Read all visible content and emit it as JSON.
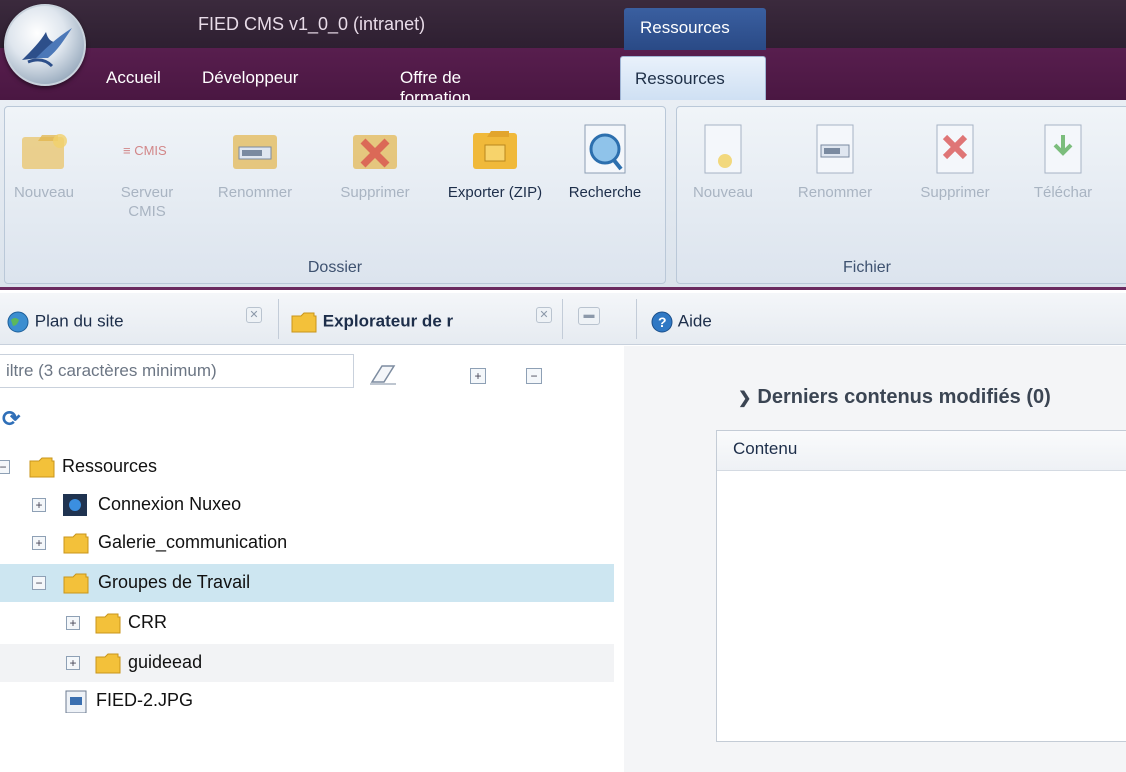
{
  "app": {
    "title": "FIED CMS v1_0_0 (intranet)",
    "context_tab": "Ressources"
  },
  "tabs": [
    {
      "label": "Accueil"
    },
    {
      "label": "Développeur"
    },
    {
      "label": "Offre de formation"
    },
    {
      "label": "Ressources",
      "active": true
    }
  ],
  "ribbon": {
    "dossier": {
      "label": "Dossier",
      "buttons": [
        {
          "label": "Nouveau",
          "icon": "folder-new-icon",
          "enabled": false
        },
        {
          "label": "Serveur CMIS",
          "icon": "cmis-icon",
          "enabled": false
        },
        {
          "label": "Renommer",
          "icon": "folder-rename-icon",
          "enabled": false
        },
        {
          "label": "Supprimer",
          "icon": "folder-delete-icon",
          "enabled": false
        },
        {
          "label": "Exporter (ZIP)",
          "icon": "folder-export-icon",
          "enabled": true
        },
        {
          "label": "Recherche",
          "icon": "search-icon",
          "enabled": true
        }
      ]
    },
    "fichier": {
      "label": "Fichier",
      "buttons": [
        {
          "label": "Nouveau",
          "icon": "file-new-icon",
          "enabled": false
        },
        {
          "label": "Renommer",
          "icon": "file-rename-icon",
          "enabled": false
        },
        {
          "label": "Supprimer",
          "icon": "file-delete-icon",
          "enabled": false
        },
        {
          "label": "Téléchar",
          "icon": "file-download-icon",
          "enabled": false
        }
      ]
    }
  },
  "panel_tabs": [
    {
      "label": "Plan du site",
      "icon": "globe-icon"
    },
    {
      "label": "Explorateur de r",
      "icon": "folder-icon",
      "active": true
    },
    {
      "label": "Aide",
      "icon": "help-icon"
    }
  ],
  "explorer": {
    "filter_placeholder": "iltre (3 caractères minimum)",
    "tree": [
      {
        "label": "Ressources",
        "level": 0,
        "expanded": true,
        "icon": "folder-icon"
      },
      {
        "label": "Connexion Nuxeo",
        "level": 1,
        "expanded": false,
        "icon": "nuxeo-icon"
      },
      {
        "label": "Galerie_communication",
        "level": 1,
        "expanded": false,
        "icon": "folder-icon"
      },
      {
        "label": "Groupes de Travail",
        "level": 1,
        "expanded": true,
        "selected": true,
        "icon": "folder-icon"
      },
      {
        "label": "CRR",
        "level": 2,
        "expanded": false,
        "icon": "folder-icon"
      },
      {
        "label": "guideead",
        "level": 2,
        "expanded": false,
        "icon": "folder-icon"
      },
      {
        "label": "FIED-2.JPG",
        "level": 1,
        "icon": "image-file-icon"
      }
    ]
  },
  "recent": {
    "title": "Derniers contenus modifiés (0)",
    "column": "Contenu"
  },
  "colors": {
    "ribbon_accent": "#6b2a5f",
    "selection": "#cde6f1",
    "context_tab": "#2a4a86"
  }
}
